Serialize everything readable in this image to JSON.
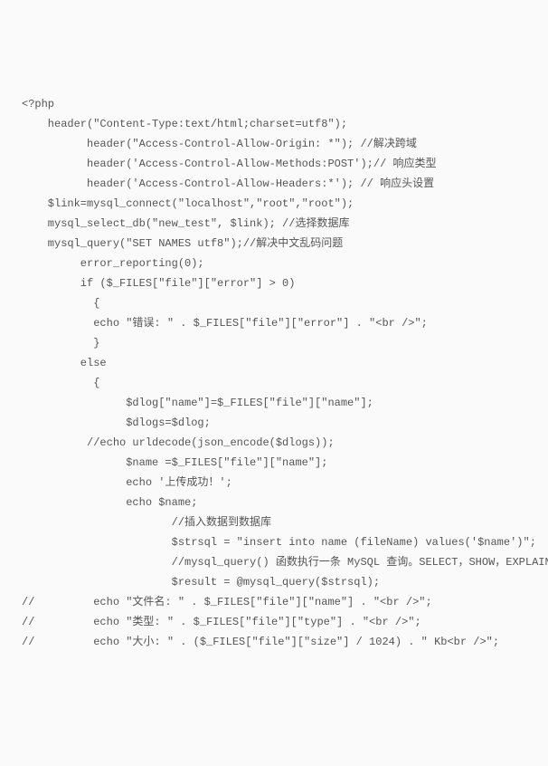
{
  "lines": [
    "<?php",
    "    header(\"Content-Type:text/html;charset=utf8\");",
    "          header(\"Access-Control-Allow-Origin: *\"); //解决跨域",
    "          header('Access-Control-Allow-Methods:POST');// 响应类型",
    "          header('Access-Control-Allow-Headers:*'); // 响应头设置",
    "    $link=mysql_connect(\"localhost\",\"root\",\"root\");",
    "    mysql_select_db(\"new_test\", $link); //选择数据库",
    "    mysql_query(\"SET NAMES utf8\");//解决中文乱码问题",
    "         error_reporting(0);",
    "         if ($_FILES[\"file\"][\"error\"] > 0)",
    "           {",
    "           echo \"错误: \" . $_FILES[\"file\"][\"error\"] . \"<br />\";",
    "           }",
    "         else",
    "           {",
    "                $dlog[\"name\"]=$_FILES[\"file\"][\"name\"];",
    "                $dlogs=$dlog;",
    "          //echo urldecode(json_encode($dlogs));",
    "                $name =$_FILES[\"file\"][\"name\"];",
    "                echo '上传成功！';",
    "                echo $name;",
    "                       //插入数据到数据库",
    "                       $strsql = \"insert into name (fileName) values('$name')\";",
    "                       //mysql_query() 函数执行一条 MySQL 查询。SELECT，SHOW，EXPLAIN",
    "                       $result = @mysql_query($strsql);",
    "//         echo \"文件名: \" . $_FILES[\"file\"][\"name\"] . \"<br />\";",
    "//         echo \"类型: \" . $_FILES[\"file\"][\"type\"] . \"<br />\";",
    "//         echo \"大小: \" . ($_FILES[\"file\"][\"size\"] / 1024) . \" Kb<br />\";"
  ]
}
